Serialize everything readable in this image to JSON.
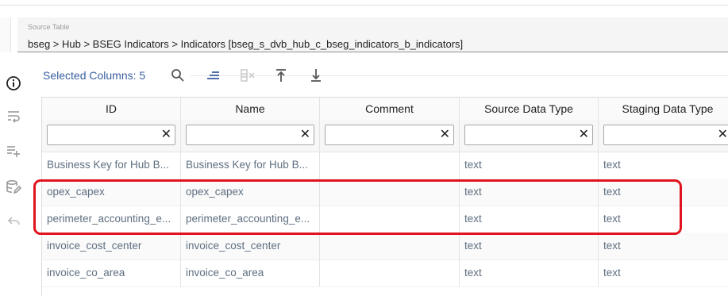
{
  "source": {
    "label": "Source Table",
    "value": "bseg > Hub > BSEG Indicators > Indicators [bseg_s_dvb_hub_c_bseg_indicators_b_indicators]"
  },
  "toolbar": {
    "selected_columns": "Selected Columns: 5",
    "buttons": [
      "search-icon",
      "sort-lines-icon",
      "remove-column-icon",
      "move-top-icon",
      "move-bottom-icon"
    ]
  },
  "sidebar": {
    "icons": [
      "info-icon",
      "wrap-text-icon",
      "add-list-icon",
      "database-edit-icon",
      "undo-icon"
    ]
  },
  "grid": {
    "columns": [
      "ID",
      "Name",
      "Comment",
      "Source Data Type",
      "Staging Data Type"
    ],
    "filters": [
      "",
      "",
      "",
      "",
      ""
    ],
    "rows": [
      [
        "Business Key for Hub B...",
        "Business Key for Hub B...",
        "",
        "text",
        "text"
      ],
      [
        "opex_capex",
        "opex_capex",
        "",
        "text",
        "text"
      ],
      [
        "perimeter_accounting_e...",
        "perimeter_accounting_e...",
        "",
        "text",
        "text"
      ],
      [
        "invoice_cost_center",
        "invoice_cost_center",
        "",
        "text",
        "text"
      ],
      [
        "invoice_co_area",
        "invoice_co_area",
        "",
        "text",
        "text"
      ]
    ]
  },
  "colors": {
    "accent": "#3a5fa0",
    "highlight": "#e0141e"
  }
}
